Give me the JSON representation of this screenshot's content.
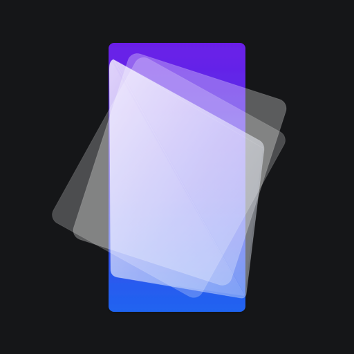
{
  "app_icon": {
    "icon": "stacked-translucent-cards-icon",
    "colors": {
      "background": "#151618",
      "gradient_purple": "#6a1fe8",
      "gradient_mid": "#4a39ea",
      "gradient_blue": "#1f64f0",
      "glass_white": "#ffffff"
    }
  }
}
